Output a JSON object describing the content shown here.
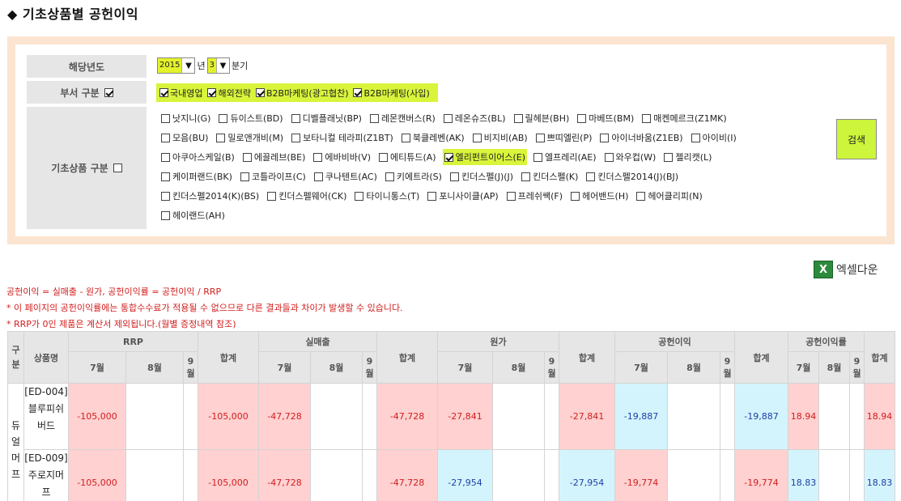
{
  "page": {
    "title": "◆ 기초상품별 공헌이익"
  },
  "filters": {
    "year_label": "해당년도",
    "year_value": "2015",
    "year_unit": "년",
    "quarter_value": "3",
    "quarter_unit": "분기",
    "dept_label": "부서 구분",
    "dept_items": [
      {
        "label": "국내영업",
        "checked": true
      },
      {
        "label": "해외전략",
        "checked": true
      },
      {
        "label": "B2B마케팅(광고협찬)",
        "checked": true
      },
      {
        "label": "B2B마케팅(사입)",
        "checked": true
      }
    ],
    "product_label": "기초상품 구분",
    "product_lines": [
      [
        {
          "label": "낫지니(G)"
        },
        {
          "label": "듀이스트(BD)"
        },
        {
          "label": "디벨플래닛(BP)"
        },
        {
          "label": "레몬캔버스(R)"
        },
        {
          "label": "레온슈즈(BL)"
        },
        {
          "label": "릴헤븐(BH)"
        },
        {
          "label": "마베뜨(BM)"
        },
        {
          "label": "매켄메르크(Z1MK)"
        }
      ],
      [
        {
          "label": "모음(BU)"
        },
        {
          "label": "밀로앤개비(M)"
        },
        {
          "label": "보타니컬 테라피(Z1BT)"
        },
        {
          "label": "북클레벤(AK)"
        },
        {
          "label": "비지비(AB)"
        },
        {
          "label": "쁘띠엘린(P)"
        },
        {
          "label": "아이너바움(Z1EB)"
        },
        {
          "label": "아이비(I)"
        }
      ],
      [
        {
          "label": "아쿠아스케일(B)"
        },
        {
          "label": "에끌레브(BE)"
        },
        {
          "label": "에바비바(V)"
        },
        {
          "label": "에티튜드(A)"
        },
        {
          "label": "엘리펀트이어스(E)",
          "checked": true
        },
        {
          "label": "엘프레리(AE)"
        },
        {
          "label": "와우컵(W)"
        },
        {
          "label": "젤리캣(L)"
        }
      ],
      [
        {
          "label": "케이퍼랜드(BK)"
        },
        {
          "label": "코틀라이프(C)"
        },
        {
          "label": "쿠나텐트(AC)"
        },
        {
          "label": "키에트라(S)"
        },
        {
          "label": "킨더스펠(J)(J)"
        },
        {
          "label": "킨더스펠(K)"
        },
        {
          "label": "킨더스펠2014(J)(BJ)"
        }
      ],
      [
        {
          "label": "킨더스펠2014(K)(BS)"
        },
        {
          "label": "킨더스펠웨어(CK)"
        },
        {
          "label": "타이니통스(T)"
        },
        {
          "label": "포니사이클(AP)"
        },
        {
          "label": "프레쉬쌕(F)"
        },
        {
          "label": "헤어밴드(H)"
        },
        {
          "label": "헤어클리피(N)"
        }
      ],
      [
        {
          "label": "헤이랜드(AH)"
        }
      ]
    ],
    "search_label": "검색"
  },
  "excel_label": "엑셀다운",
  "excel_icon": "excel-x-icon",
  "notes": [
    "공헌이익 = 실매출 - 원가, 공헌이익률 = 공헌이익 / RRP",
    "* 이 페이지의 공헌이익률에는 통합수수료가 적용될 수 없으므로 다른 결과들과 차이가 발생할 수 있습니다.",
    "* RRP가 0인 제품은 계산서 제외됩니다.(월별 증정내역 참조)"
  ],
  "table": {
    "header_gubun": "구분",
    "header_name": "상품명",
    "groups": [
      "RRP",
      "실매출",
      "원가",
      "공헌이익",
      "공헌이익률"
    ],
    "months": [
      "7월",
      "8월",
      "9월"
    ],
    "total_label": "합계",
    "group_name": "듀얼머프",
    "rows": [
      {
        "name": "[ED-004] 블루피쉬버드",
        "rrp": [
          "-105,000",
          "",
          "",
          "-105,000"
        ],
        "sales": [
          "-47,728",
          "",
          "",
          "-47,728"
        ],
        "cost": [
          "-27,841",
          "",
          "",
          "-27,841"
        ],
        "profit": [
          "-19,887",
          "",
          "",
          "-19,887"
        ],
        "rate": [
          "18.94",
          "",
          "",
          "18.94"
        ]
      },
      {
        "name": "[ED-009] 주로지머프",
        "rrp": [
          "-105,000",
          "",
          "",
          "-105,000"
        ],
        "sales": [
          "-47,728",
          "",
          "",
          "-47,728"
        ],
        "cost": [
          "-27,954",
          "",
          "",
          "-27,954"
        ],
        "profit": [
          "-19,774",
          "",
          "",
          "-19,774"
        ],
        "rate": [
          "18.83",
          "",
          "",
          "18.83"
        ]
      }
    ]
  }
}
